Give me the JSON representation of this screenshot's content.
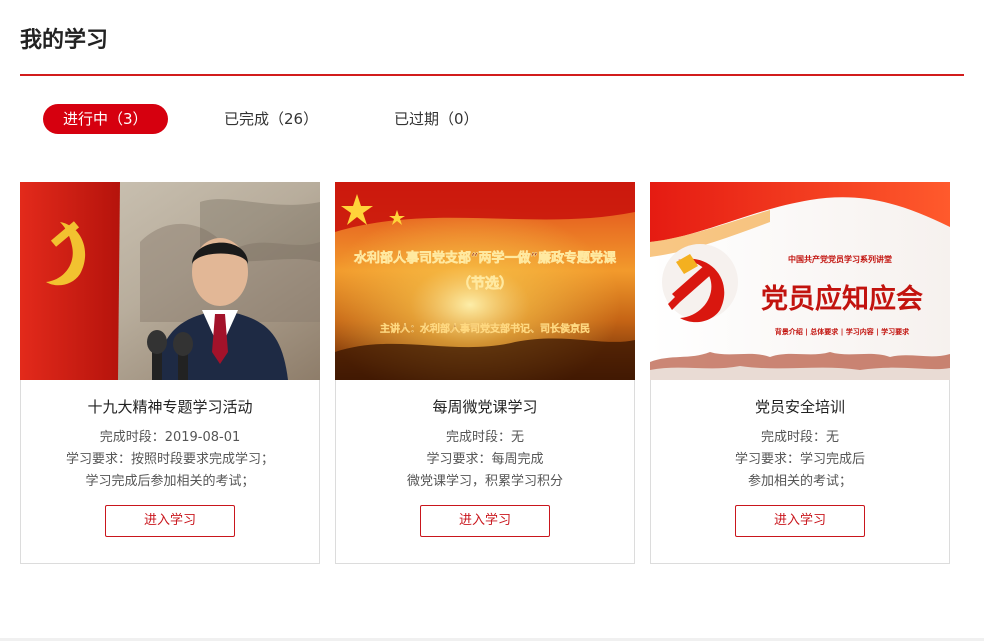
{
  "page": {
    "title": "我的学习"
  },
  "tabs": [
    {
      "label": "进行中（3）",
      "active": true
    },
    {
      "label": "已完成（26）",
      "active": false
    },
    {
      "label": "已过期（0）",
      "active": false
    }
  ],
  "courses": [
    {
      "title": "十九大精神专题学习活动",
      "period": "完成时段：2019-08-01",
      "requirement_lines": [
        "学习要求：按照时段要求完成学习；",
        "学习完成后参加相关的考试；"
      ],
      "button": "进入学习"
    },
    {
      "title": "每周微党课学习",
      "period": "完成时段：无",
      "requirement_lines": [
        "学习要求：每周完成",
        "微党课学习，积累学习积分"
      ],
      "button": "进入学习",
      "thumb_text": {
        "line1": "水利部人事司党支部“两学一做”廉政专题党课",
        "line2": "（节选）",
        "line3": "主讲人：水利部人事司党支部书记、司长侯京民"
      }
    },
    {
      "title": "党员安全培训",
      "period": "完成时段：无",
      "requirement_lines": [
        "学习要求：学习完成后",
        "参加相关的考试；"
      ],
      "button": "进入学习",
      "thumb_text": {
        "top": "中国共产党党员学习系列讲堂",
        "headline": "党员应知应会",
        "sub": "背景介绍 | 总体要求 | 学习内容 | 学习要求"
      }
    }
  ],
  "colors": {
    "accent": "#d21c1c",
    "tab_active_bg": "#d6000f"
  }
}
